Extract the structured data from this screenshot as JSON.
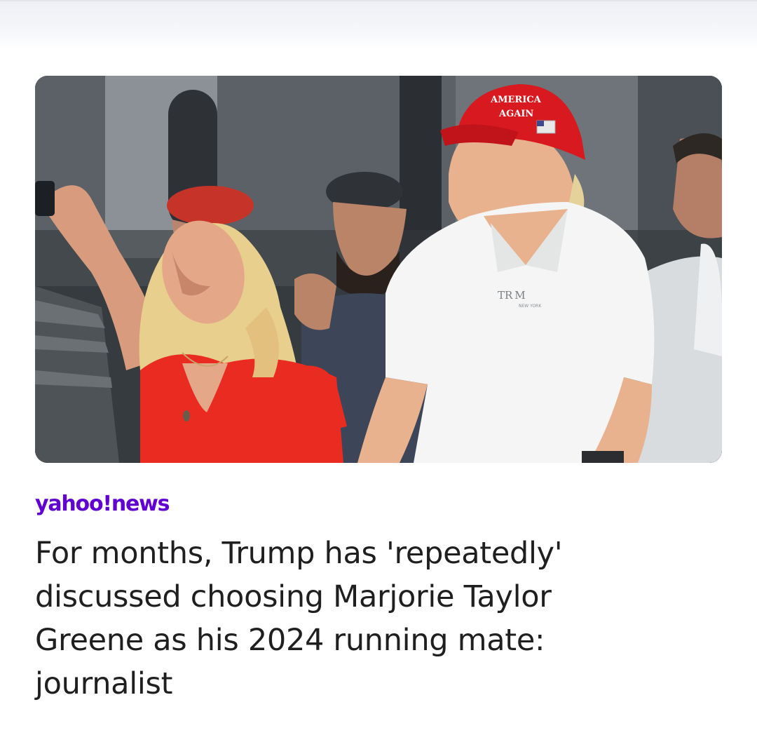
{
  "article": {
    "source": {
      "name": "yahoo!news",
      "brand_color": "#6001d2"
    },
    "headline": "For months, Trump has 'repeatedly' discussed choosing Marjorie Taylor Greene as his 2024 running mate: journalist",
    "image": {
      "cap_text_line1": "AMERICA",
      "cap_text_line2": "AGAIN",
      "shirt_logo": "TR M",
      "shirt_logo_sub": "NEW YORK"
    }
  },
  "colors": {
    "cap_red": "#d8191f",
    "dress_red": "#ea2b22",
    "shirt_white": "#f4f5f4",
    "headline_text": "#1f1f1f"
  }
}
